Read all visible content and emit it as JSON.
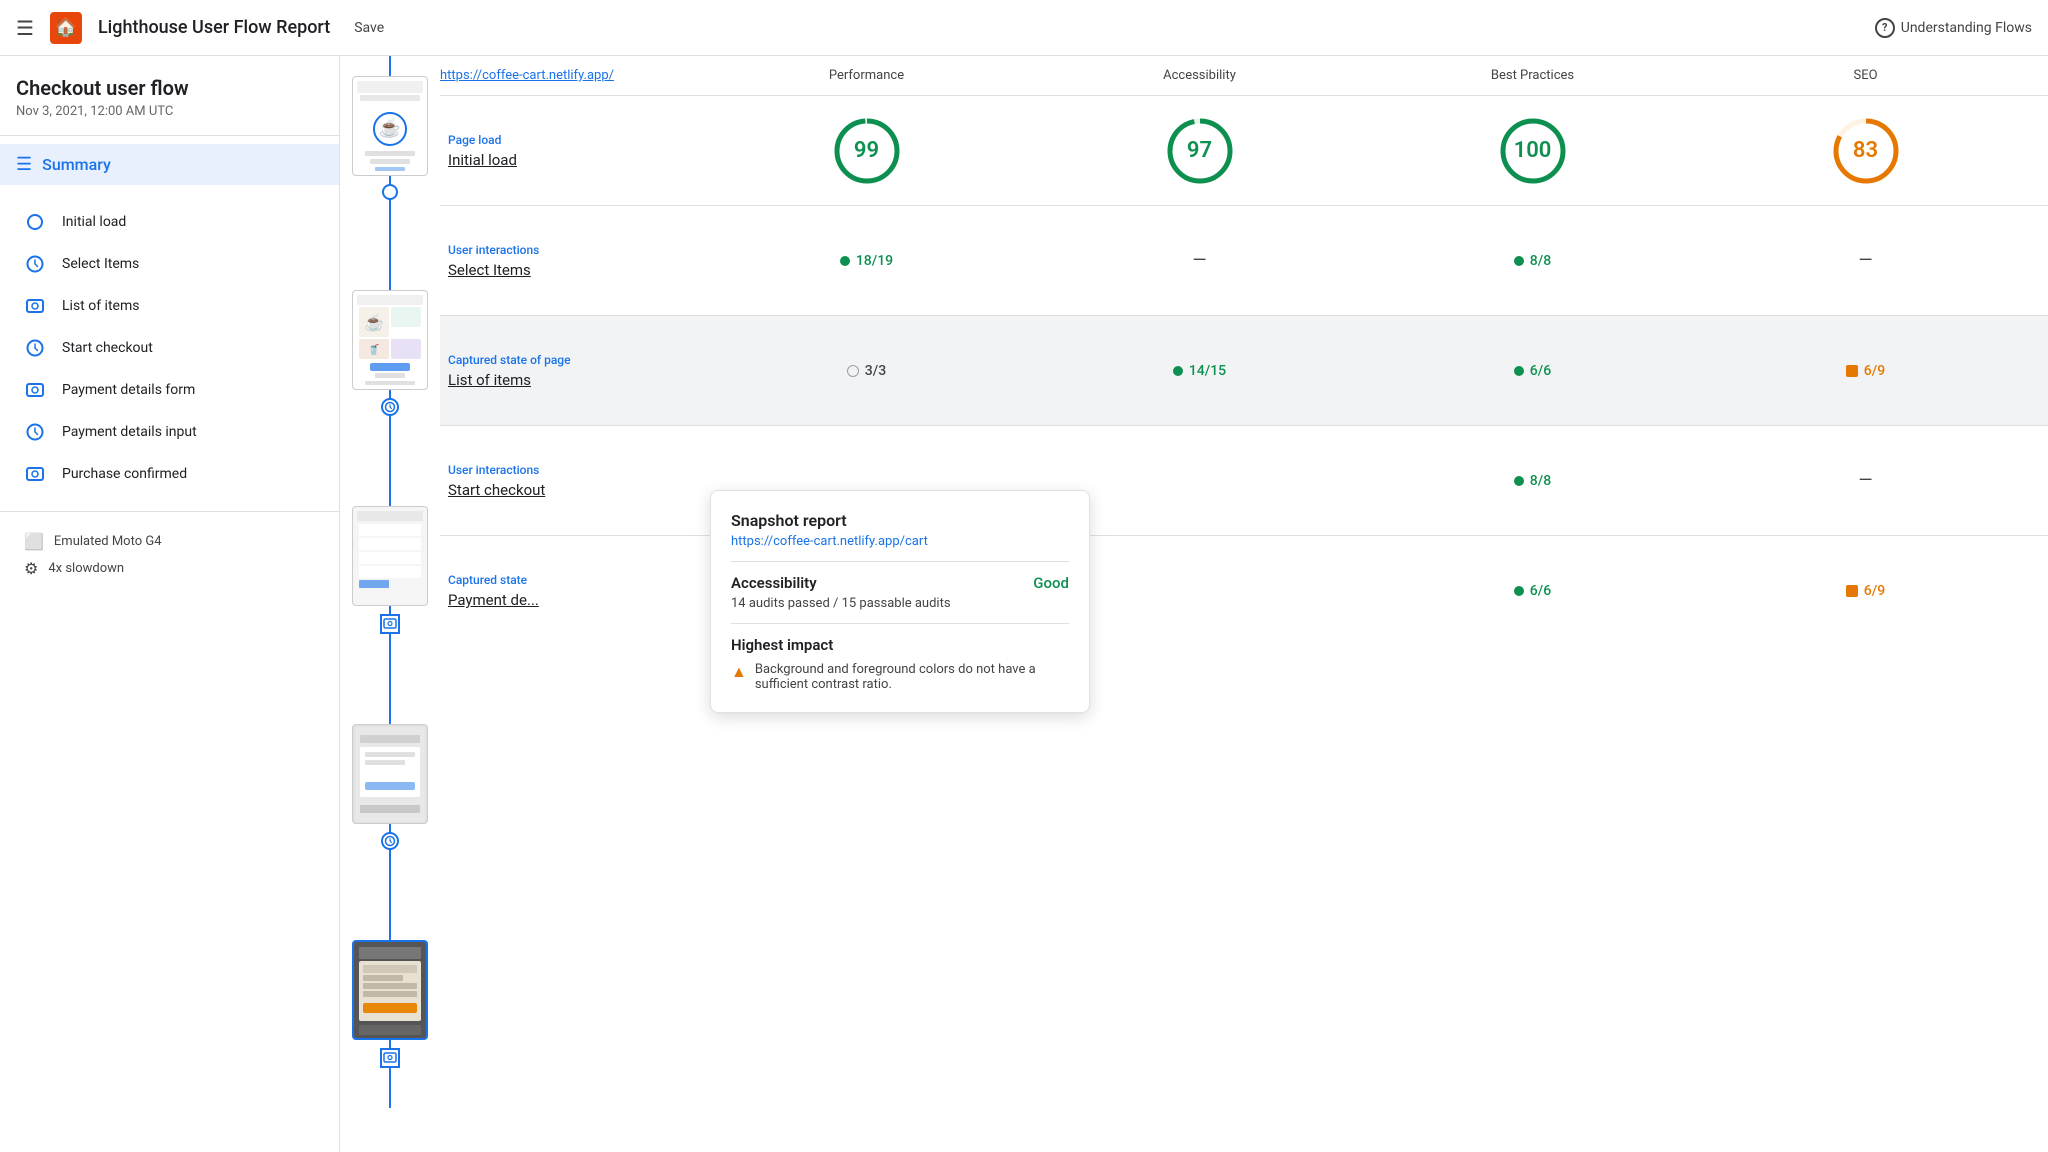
{
  "header": {
    "title": "Lighthouse User Flow Report",
    "save_label": "Save",
    "help_label": "Understanding Flows"
  },
  "sidebar": {
    "flow_title": "Checkout user flow",
    "flow_date": "Nov 3, 2021, 12:00 AM UTC",
    "summary_label": "Summary",
    "items": [
      {
        "label": "Initial load",
        "type": "circle"
      },
      {
        "label": "Select Items",
        "type": "clock"
      },
      {
        "label": "List of items",
        "type": "snapshot"
      },
      {
        "label": "Start checkout",
        "type": "clock"
      },
      {
        "label": "Payment details form",
        "type": "snapshot"
      },
      {
        "label": "Payment details input",
        "type": "clock"
      },
      {
        "label": "Purchase confirmed",
        "type": "snapshot"
      }
    ],
    "device_label": "Emulated Moto G4",
    "slowdown_label": "4x slowdown"
  },
  "columns": {
    "url": "https://coffee-cart.netlify.app/",
    "performance": "Performance",
    "accessibility": "Accessibility",
    "best_practices": "Best Practices",
    "seo": "SEO"
  },
  "rows": [
    {
      "type_label": "Page load",
      "name": "Initial load",
      "performance": {
        "kind": "circle",
        "value": 99,
        "color": "green"
      },
      "accessibility": {
        "kind": "circle",
        "value": 97,
        "color": "green"
      },
      "best_practices": {
        "kind": "circle",
        "value": 100,
        "color": "green"
      },
      "seo": {
        "kind": "circle",
        "value": 83,
        "color": "orange"
      }
    },
    {
      "type_label": "User interactions",
      "name": "Select Items",
      "performance": {
        "kind": "badge",
        "value": "18/19",
        "color": "green"
      },
      "accessibility": {
        "kind": "dash"
      },
      "best_practices": {
        "kind": "badge",
        "value": "8/8",
        "color": "green"
      },
      "seo": {
        "kind": "dash"
      },
      "highlighted": false
    },
    {
      "type_label": "Captured state of page",
      "name": "List of items",
      "performance": {
        "kind": "badge",
        "value": "3/3",
        "color": "gray"
      },
      "accessibility": {
        "kind": "badge",
        "value": "14/15",
        "color": "green"
      },
      "best_practices": {
        "kind": "badge",
        "value": "6/6",
        "color": "green"
      },
      "seo": {
        "kind": "badge",
        "value": "6/9",
        "color": "orange"
      },
      "highlighted": true
    },
    {
      "type_label": "User interactions",
      "name": "Start checkout",
      "performance": {
        "kind": "hidden"
      },
      "accessibility": {
        "kind": "hidden"
      },
      "best_practices": {
        "kind": "badge",
        "value": "8/8",
        "color": "green"
      },
      "seo": {
        "kind": "dash"
      },
      "highlighted": false,
      "partial": true
    },
    {
      "type_label": "Captured state",
      "name": "Payment de...",
      "performance": {
        "kind": "hidden"
      },
      "accessibility": {
        "kind": "hidden"
      },
      "best_practices": {
        "kind": "badge",
        "value": "6/6",
        "color": "green"
      },
      "seo": {
        "kind": "badge",
        "value": "6/9",
        "color": "orange"
      },
      "highlighted": false
    }
  ],
  "tooltip": {
    "title": "Snapshot report",
    "url": "https://coffee-cart.netlify.app/cart",
    "section_title": "Accessibility",
    "section_status": "Good",
    "section_desc": "14 audits passed / 15 passable audits",
    "impact_title": "Highest impact",
    "impact_items": [
      {
        "text": "Background and foreground colors do not have a sufficient contrast ratio."
      }
    ]
  },
  "colors": {
    "green": "#0d904f",
    "orange": "#e67700",
    "blue": "#1a73e8",
    "gray": "#9aa0a6"
  }
}
